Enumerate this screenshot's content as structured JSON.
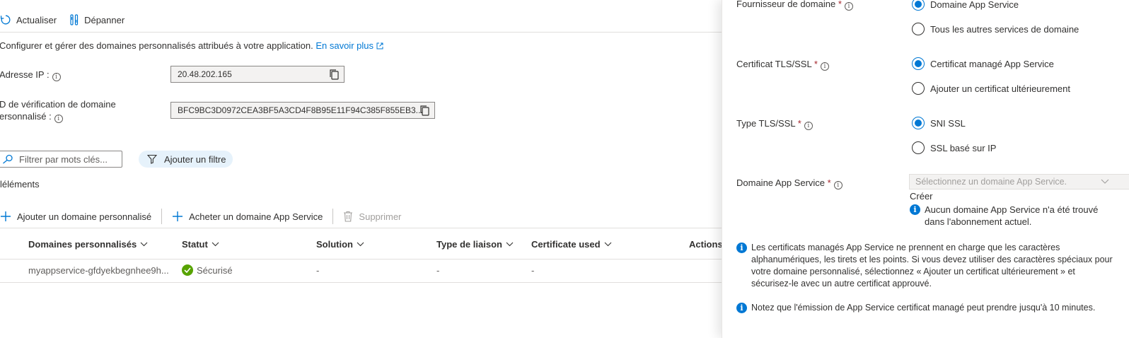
{
  "toolbar": {
    "refresh_label": "Actualiser",
    "troubleshoot_label": "Dépanner"
  },
  "description": {
    "text": "Configurer et gérer des domaines personnalisés attribués à votre application.",
    "learn_more": "En savoir plus"
  },
  "ip": {
    "label": "Adresse IP :",
    "value": "20.48.202.165"
  },
  "verification": {
    "label_line1": "D de vérification de domaine",
    "label_line2": "ersonnalisé :",
    "value": "BFC9BC3D0972CEA3BF5A3CD4F8B95E11F94C385F855EB3..."
  },
  "filter": {
    "placeholder": "Filtrer par mots clés...",
    "add_filter": "Ajouter un filtre"
  },
  "items_count": "léléments",
  "actions": {
    "add_custom": "Ajouter un domaine personnalisé",
    "buy_domain": "Acheter un domaine App Service",
    "delete": "Supprimer"
  },
  "table": {
    "headers": [
      "Domaines personnalisés",
      "Statut",
      "Solution",
      "Type de liaison",
      "Certificate used",
      "Actions"
    ],
    "rows": [
      {
        "domain": "myappservice-gfdyekbegnhee9h...",
        "status": "Sécurisé",
        "solution": "-",
        "binding": "-",
        "certificate": "-"
      }
    ]
  },
  "panel": {
    "provider": {
      "label": "Fournisseur de domaine",
      "options": [
        "Domaine App Service",
        "Tous les autres services de domaine"
      ],
      "selected": 0
    },
    "certificate": {
      "label": "Certificat TLS/SSL",
      "options": [
        "Certificat managé App Service",
        "Ajouter un certificat ultérieurement"
      ],
      "selected": 0
    },
    "tls_type": {
      "label": "Type TLS/SSL",
      "options": [
        "SNI SSL",
        "SSL basé sur IP"
      ],
      "selected": 0
    },
    "app_domain": {
      "label": "Domaine App Service",
      "placeholder": "Sélectionnez un domaine App Service.",
      "create": "Créer",
      "none_line1": "Aucun domaine App Service n'a été trouvé",
      "none_line2": "dans l'abonnement actuel."
    },
    "note1_lines": [
      "Les certificats managés App Service ne prennent en charge que les caractères",
      "alphanumériques, les tirets et les points. Si vous devez utiliser des caractères spéciaux pour",
      "votre domaine personnalisé, sélectionnez « Ajouter un certificat ultérieurement » et",
      "sécurisez-le avec un autre certificat approuvé."
    ],
    "note2": "Notez que l'émission de App Service certificat managé peut prendre jusqu'à 10 minutes."
  },
  "colors": {
    "accent": "#0078d4",
    "success": "#57a300",
    "required": "#a4262c"
  }
}
